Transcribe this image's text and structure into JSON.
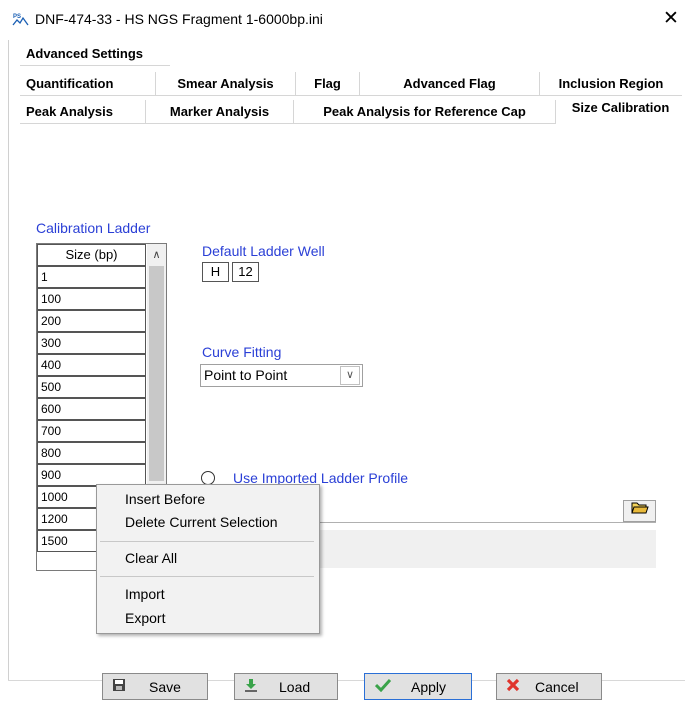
{
  "window": {
    "title": "DNF-474-33 - HS NGS Fragment 1-6000bp.ini",
    "close": "✕",
    "app_icon_text": "PSA"
  },
  "tabs": {
    "row1": [
      "Advanced Settings"
    ],
    "row2": [
      "Quantification",
      "Smear Analysis",
      "Flag",
      "Advanced Flag",
      "Inclusion Region"
    ],
    "row3": [
      "Peak Analysis",
      "Marker Analysis",
      "Peak Analysis for Reference Cap",
      "Size Calibration"
    ],
    "active": "Size Calibration"
  },
  "calibration": {
    "label": "Calibration Ladder",
    "column_header": "Size (bp)",
    "sizes": [
      "1",
      "100",
      "200",
      "300",
      "400",
      "500",
      "600",
      "700",
      "800",
      "900",
      "1000",
      "1200",
      "1500"
    ]
  },
  "default_ladder_well": {
    "label": "Default Ladder Well",
    "row": "H",
    "col": "12"
  },
  "curve_fitting": {
    "label": "Curve Fitting",
    "selected": "Point to Point"
  },
  "imported_profile": {
    "label": "Use Imported Ladder Profile"
  },
  "context_menu": {
    "items": [
      "Insert Before",
      "Delete Current Selection",
      "Clear All",
      "Import",
      "Export"
    ]
  },
  "buttons": {
    "save": "Save",
    "load": "Load",
    "apply": "Apply",
    "cancel": "Cancel"
  },
  "colors": {
    "accent_blue": "#2a3fd6"
  }
}
